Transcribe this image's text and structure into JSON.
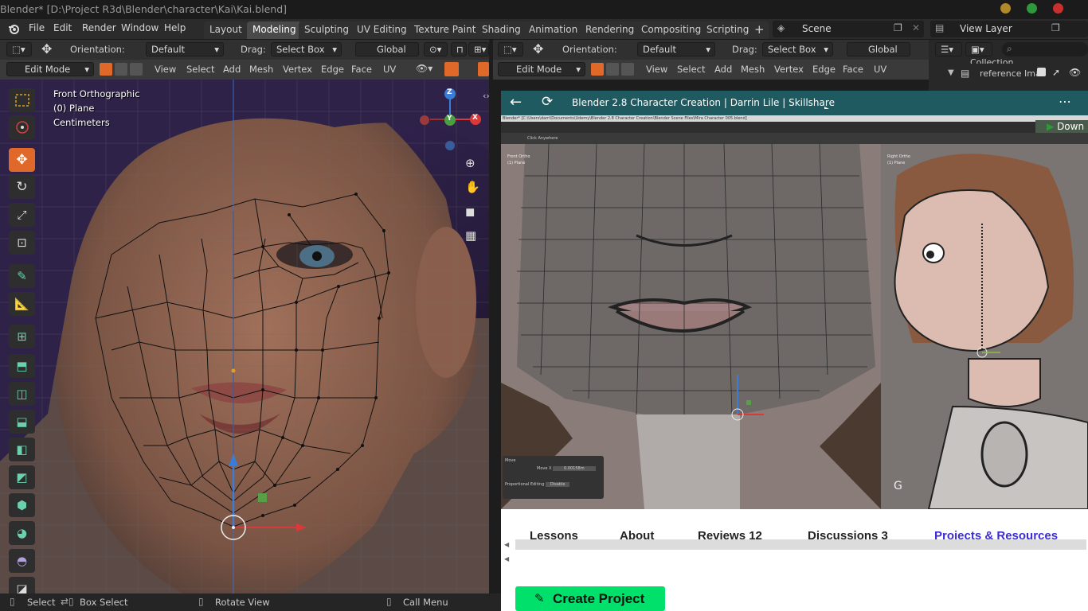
{
  "window": {
    "title": "Blender* [D:\\Project R3d\\Blender\\character\\Kai\\Kai.blend]"
  },
  "menus": [
    "File",
    "Edit",
    "Render",
    "Window",
    "Help"
  ],
  "workspaces": [
    "Layout",
    "Modeling",
    "Sculpting",
    "UV Editing",
    "Texture Paint",
    "Shading",
    "Animation",
    "Rendering",
    "Compositing",
    "Scripting"
  ],
  "active_workspace": "Modeling",
  "scene": {
    "label": "Scene",
    "view_layer": "View Layer"
  },
  "header_left": {
    "orientation_label": "Orientation:",
    "orientation_value": "Default",
    "drag_label": "Drag:",
    "drag_value": "Select Box",
    "transform_value": "Global"
  },
  "header_right": {
    "orientation_label": "Orientation:",
    "orientation_value": "Default",
    "drag_label": "Drag:",
    "drag_value": "Select Box",
    "transform_value": "Global"
  },
  "edit_header_left": {
    "mode": "Edit Mode",
    "items": [
      "View",
      "Select",
      "Add",
      "Mesh",
      "Vertex",
      "Edge",
      "Face",
      "UV"
    ]
  },
  "edit_header_right": {
    "mode": "Edit Mode",
    "items": [
      "View",
      "Select",
      "Add",
      "Mesh",
      "Vertex",
      "Edge",
      "Face",
      "UV"
    ]
  },
  "viewport": {
    "view": "Front Orthographic",
    "object": "(0) Plane",
    "units": "Centimeters"
  },
  "axes": {
    "z": "Z",
    "y": "Y",
    "x": "X"
  },
  "outliner": {
    "collection": "Collection",
    "reference": "reference Ima"
  },
  "browser": {
    "title": "Blender 2.8 Character Creation | Darrin Lile | Skillshare",
    "download": "Down"
  },
  "video": {
    "title_bar": "Blender* [C:\\Users\\darri\\Documents\\Udemy\\Blender 2.8 Character Creation\\Blender Scene Files\\Mira Character 005.blend]",
    "left_view": "Front Ortho",
    "left_obj": "(1) Plane",
    "right_view": "Right Ortho",
    "right_obj": "(1) Plane",
    "move_panel": "Move",
    "move_x": "Move X",
    "move_x_val": "0.00158m",
    "prop_edit": "Proportional Editing",
    "prop_val": "Disable",
    "key": "G",
    "click_anywhere": "Click Anywhere"
  },
  "tabs": [
    "Lessons",
    "About",
    "Reviews 12",
    "Discussions 3",
    "Projects & Resources"
  ],
  "cta": {
    "label": "Create Project"
  },
  "status": {
    "select": "Select",
    "box_select": "Box Select",
    "rotate": "Rotate View",
    "call_menu": "Call Menu"
  },
  "colors": {
    "accent": "#e0692a",
    "teal": "#1e5a60",
    "green_cta": "#00e06b",
    "link": "#3b2cd6"
  }
}
